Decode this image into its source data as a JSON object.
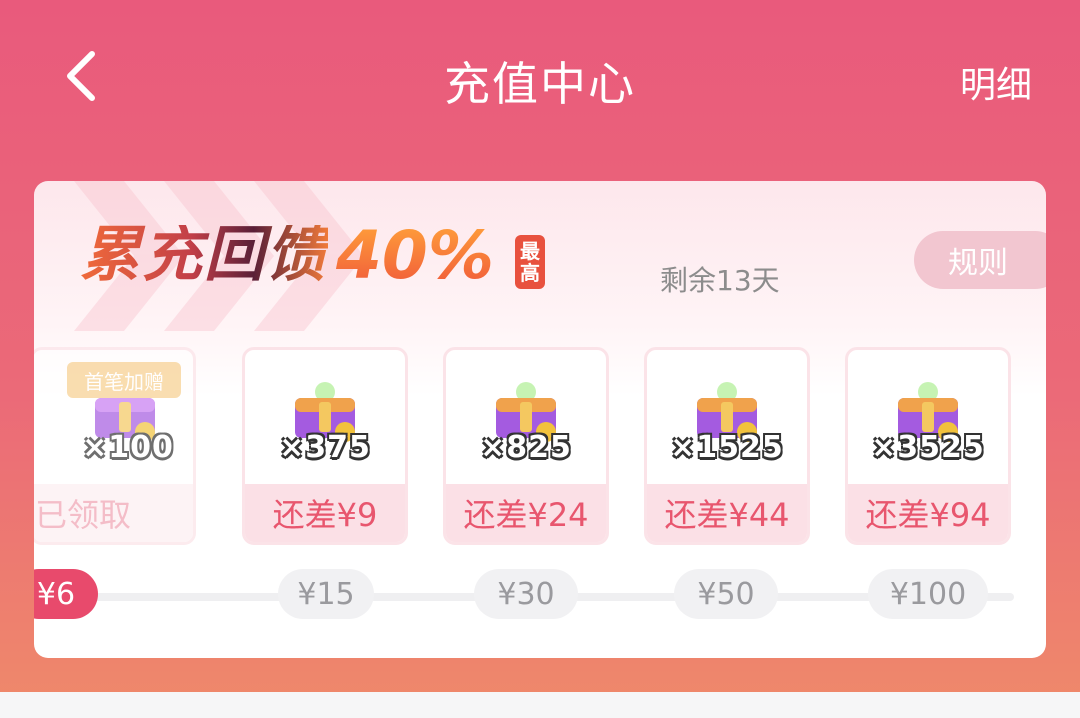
{
  "header": {
    "title": "充值中心",
    "detail_label": "明细"
  },
  "promo": {
    "title": "累充回馈",
    "percent": "40%",
    "badge_top": "最",
    "badge_bottom": "高",
    "remaining": "剩余13天",
    "rules_label": "规则"
  },
  "tiers": [
    {
      "badge": "首笔加赠",
      "qty": "×100",
      "status": "已领取"
    },
    {
      "qty": "×375",
      "status": "还差¥9"
    },
    {
      "qty": "×825",
      "status": "还差¥24"
    },
    {
      "qty": "×1525",
      "status": "还差¥44"
    },
    {
      "qty": "×3525",
      "status": "还差¥94"
    }
  ],
  "milestones": [
    "¥6",
    "¥15",
    "¥30",
    "¥50",
    "¥100"
  ],
  "colors": {
    "brand": "#e95a7c",
    "accent": "#e84a6c",
    "badge": "#f7d08f"
  },
  "icons": {
    "back": "chevron-left-icon",
    "chest": "treasure-chest-icon"
  }
}
